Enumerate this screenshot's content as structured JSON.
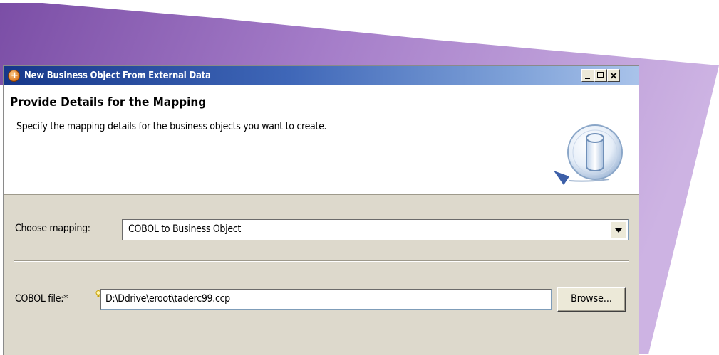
{
  "window": {
    "title": "New Business Object From External Data"
  },
  "banner": {
    "title": "Provide Details for the Mapping",
    "description": "Specify the mapping details for the business objects you want to create.",
    "icon": "database-cylinder-icon"
  },
  "mapping": {
    "label": "Choose mapping:",
    "selected": "COBOL to Business Object"
  },
  "cobol_file": {
    "label": "COBOL file:*",
    "value": "D:\\Ddrive\\eroot\\taderc99.ccp",
    "browse_label": "Browse..."
  },
  "colors": {
    "titlebar_start": "#16378a",
    "titlebar_end": "#a9c3ea",
    "dialog_background": "#ddd9cc",
    "backdrop_purple": "#8d6bb8"
  }
}
